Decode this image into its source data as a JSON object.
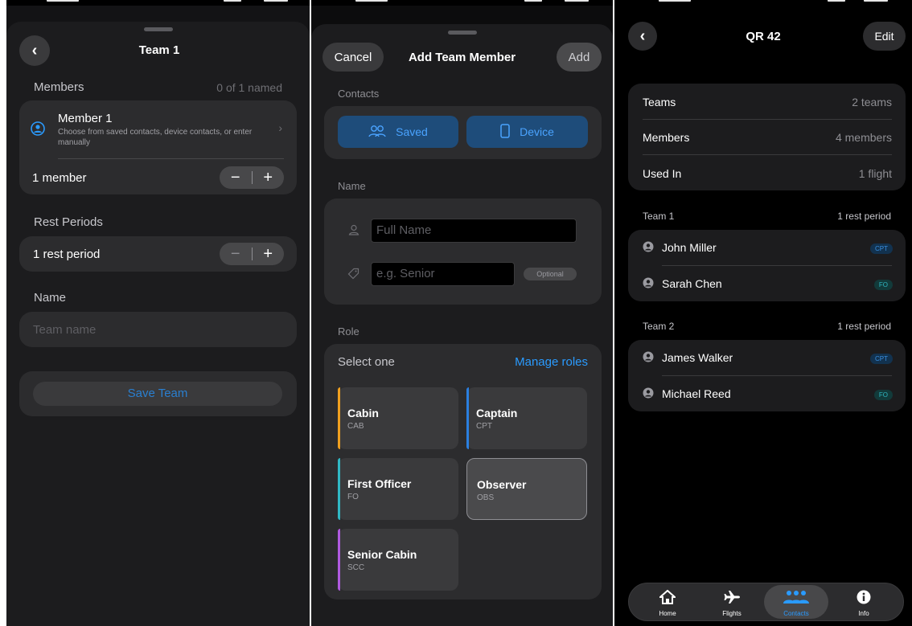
{
  "screen1": {
    "title": "Team 1",
    "back_icon": "chevron-left-icon",
    "members_label": "Members",
    "members_count": "0 of 1 named",
    "member": {
      "name": "Member 1",
      "hint": "Choose from saved contacts, device contacts, or enter manually",
      "icon": "person-add-icon"
    },
    "member_count_text": "1 member",
    "rest_label": "Rest Periods",
    "rest_count_text": "1 rest period",
    "name_label": "Name",
    "name_placeholder": "Team name",
    "save_label": "Save Team"
  },
  "screen2": {
    "cancel_label": "Cancel",
    "title": "Add Team Member",
    "add_label": "Add",
    "contacts_label": "Contacts",
    "saved_label": "Saved",
    "device_label": "Device",
    "name_label": "Name",
    "full_name_placeholder": "Full Name",
    "seniority_placeholder": "e.g. Senior",
    "optional_label": "Optional",
    "role_label": "Role",
    "select_one": "Select one",
    "manage_roles": "Manage roles",
    "roles": [
      {
        "name": "Cabin",
        "code": "CAB",
        "accent": "#f0a020"
      },
      {
        "name": "Captain",
        "code": "CPT",
        "accent": "#2a7fe0"
      },
      {
        "name": "First Officer",
        "code": "FO",
        "accent": "#30b8c4"
      },
      {
        "name": "Observer",
        "code": "OBS",
        "accent": "#8e8e93"
      },
      {
        "name": "Senior Cabin",
        "code": "SCC",
        "accent": "#b05ae0"
      }
    ]
  },
  "screen3": {
    "title": "QR 42",
    "edit_label": "Edit",
    "summary": [
      {
        "label": "Teams",
        "value": "2 teams"
      },
      {
        "label": "Members",
        "value": "4 members"
      },
      {
        "label": "Used In",
        "value": "1 flight"
      }
    ],
    "teams": [
      {
        "name": "Team 1",
        "rest": "1 rest period",
        "members": [
          {
            "name": "John Miller",
            "role": "CPT"
          },
          {
            "name": "Sarah Chen",
            "role": "FO"
          }
        ]
      },
      {
        "name": "Team 2",
        "rest": "1 rest period",
        "members": [
          {
            "name": "James Walker",
            "role": "CPT"
          },
          {
            "name": "Michael Reed",
            "role": "FO"
          }
        ]
      }
    ],
    "tabs": [
      {
        "label": "Home",
        "icon": "house-icon"
      },
      {
        "label": "Flights",
        "icon": "airplane-icon"
      },
      {
        "label": "Contacts",
        "icon": "people-icon",
        "active": true
      },
      {
        "label": "Info",
        "icon": "info-icon"
      }
    ]
  },
  "colors": {
    "accent_blue": "#2a9bff",
    "card_bg": "#2c2c2e",
    "sheet_bg": "#1c1c1e"
  }
}
